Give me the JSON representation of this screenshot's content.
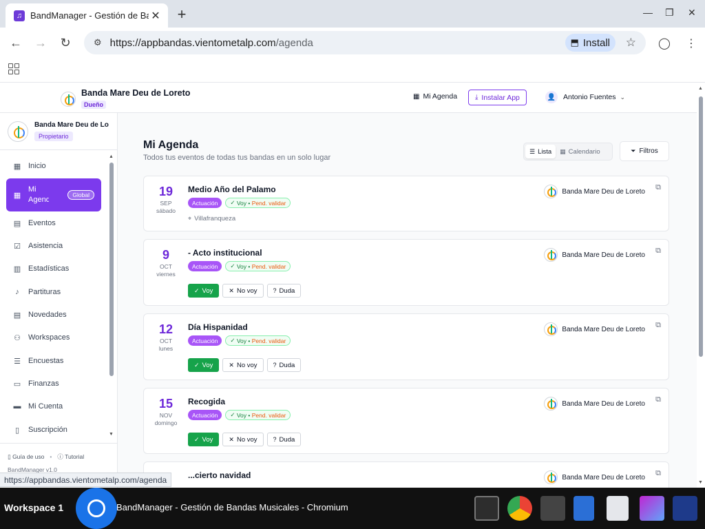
{
  "browser": {
    "tab_title": "BandManager - Gestión de Bandas Musicales",
    "url_host": "https://appbandas.vientometalp.com",
    "url_path": "/agenda",
    "install_label": "Install",
    "status_url": "https://appbandas.vientometalp.com/agenda"
  },
  "header": {
    "band_name": "Banda Mare Deu de Loreto",
    "role_badge": "Dueño",
    "agenda_link": "Mi Agenda",
    "install_button": "Instalar App",
    "user_name": "Antonio Fuentes"
  },
  "sidebar": {
    "workspace_name": "Banda Mare Deu de Loreto",
    "workspace_role": "Propietario",
    "items": [
      {
        "label": "Inicio",
        "icon": "grid-icon"
      },
      {
        "label": "Mi Agenda",
        "icon": "calendar-icon",
        "badge": "Global"
      },
      {
        "label": "Eventos",
        "icon": "calendar-icon"
      },
      {
        "label": "Asistencia",
        "icon": "clipboard-check-icon"
      },
      {
        "label": "Estadísticas",
        "icon": "bar-chart-icon"
      },
      {
        "label": "Partituras",
        "icon": "music-note-icon"
      },
      {
        "label": "Novedades",
        "icon": "newspaper-icon"
      },
      {
        "label": "Workspaces",
        "icon": "users-icon"
      },
      {
        "label": "Encuestas",
        "icon": "clipboard-list-icon"
      },
      {
        "label": "Finanzas",
        "icon": "wallet-icon"
      },
      {
        "label": "Mi Cuenta",
        "icon": "credit-card-icon"
      },
      {
        "label": "Suscripción",
        "icon": "receipt-icon"
      }
    ],
    "footer_guide": "Guía de uso",
    "footer_tutorial": "Tutorial",
    "version": "BandManager v1.0"
  },
  "main": {
    "title": "Mi Agenda",
    "subtitle": "Todos tus eventos de todas tus bandas en un solo lugar",
    "view_list": "Lista",
    "view_calendar": "Calendario",
    "filters": "Filtros"
  },
  "events": [
    {
      "day": "19",
      "month": "SEP",
      "weekday": "sábado",
      "title": "Medio Año del Palamo",
      "type": "Actuación",
      "status_going": "Voy",
      "status_pending": "Pend. validar",
      "location": "Villafranqueza",
      "band": "Banda Mare Deu de Loreto"
    },
    {
      "day": "9",
      "month": "OCT",
      "weekday": "viernes",
      "title": "- Acto institucional",
      "type": "Actuación",
      "status_going": "Voy",
      "status_pending": "Pend. validar",
      "band": "Banda Mare Deu de Loreto",
      "btn_yes": "Voy",
      "btn_no": "No voy",
      "btn_maybe": "Duda"
    },
    {
      "day": "12",
      "month": "OCT",
      "weekday": "lunes",
      "title": "Día Hispanidad",
      "type": "Actuación",
      "status_going": "Voy",
      "status_pending": "Pend. validar",
      "band": "Banda Mare Deu de Loreto",
      "btn_yes": "Voy",
      "btn_no": "No voy",
      "btn_maybe": "Duda"
    },
    {
      "day": "15",
      "month": "NOV",
      "weekday": "domingo",
      "title": "Recogida",
      "type": "Actuación",
      "status_going": "Voy",
      "status_pending": "Pend. validar",
      "band": "Banda Mare Deu de Loreto",
      "btn_yes": "Voy",
      "btn_no": "No voy",
      "btn_maybe": "Duda"
    },
    {
      "title": "...cierto navidad",
      "band": "Banda Mare Deu de Loreto"
    }
  ],
  "taskbar": {
    "workspace": "Workspace 1",
    "window_title": "BandManager - Gestión de Bandas Musicales - Chromium"
  }
}
